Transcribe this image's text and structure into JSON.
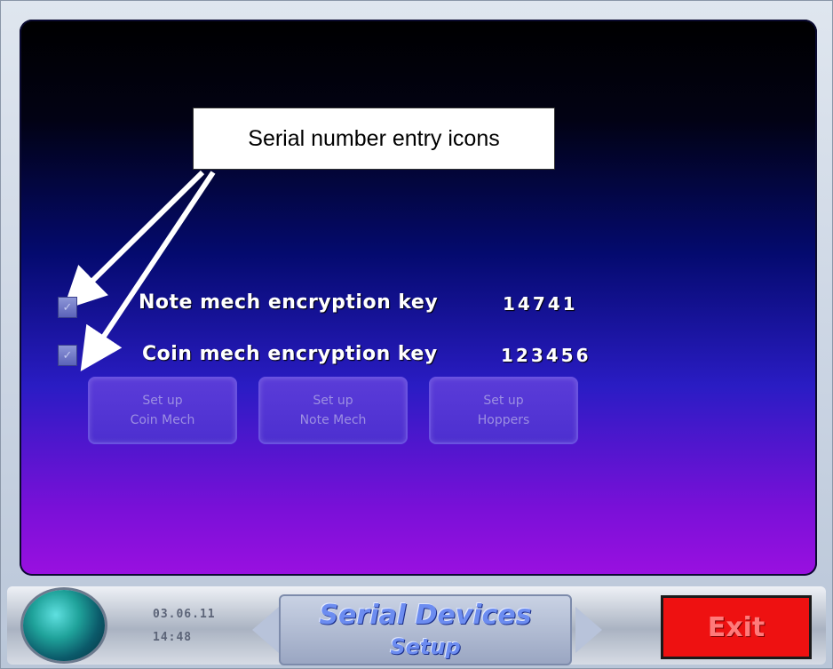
{
  "callout": {
    "text": "Serial number entry icons"
  },
  "rows": [
    {
      "check_icon": "checkbox-icon",
      "check_glyph": "✓",
      "label": "Note mech encryption key",
      "value": "14741"
    },
    {
      "check_icon": "checkbox-icon",
      "check_glyph": "✓",
      "label": "Coin mech encryption key",
      "value": "123456"
    }
  ],
  "setup_buttons": [
    {
      "line1": "Set up",
      "line2": "Coin Mech"
    },
    {
      "line1": "Set up",
      "line2": "Note Mech"
    },
    {
      "line1": "Set up",
      "line2": "Hoppers"
    }
  ],
  "footer": {
    "globe_icon": "globe-icon",
    "date": "03.06.11",
    "time": "14:48",
    "title_line1": "Serial Devices",
    "title_line2": "Setup",
    "exit_label": "Exit"
  },
  "colors": {
    "screen_top": "#000000",
    "screen_bottom": "#9a10e0",
    "exit_bg": "#ee1111"
  }
}
